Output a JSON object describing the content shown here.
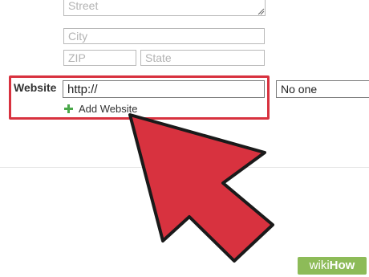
{
  "form": {
    "street": {
      "placeholder": "Street"
    },
    "city": {
      "placeholder": "City"
    },
    "zip": {
      "placeholder": "ZIP"
    },
    "state": {
      "placeholder": "State"
    },
    "website": {
      "label": "Website",
      "value": "http://",
      "add_label": "Add Website",
      "add_icon": "green-plus-icon"
    },
    "visibility": {
      "selected": "No one"
    }
  },
  "overlay": {
    "arrow_color": "#d8323f",
    "arrow_outline": "#1a1a1a",
    "highlight_color": "#d8323f"
  },
  "watermark": {
    "part1": "wiki",
    "part2": "How"
  },
  "colors": {
    "plus_icon": "#4aa84a",
    "watermark_bg": "#8dbb58"
  }
}
